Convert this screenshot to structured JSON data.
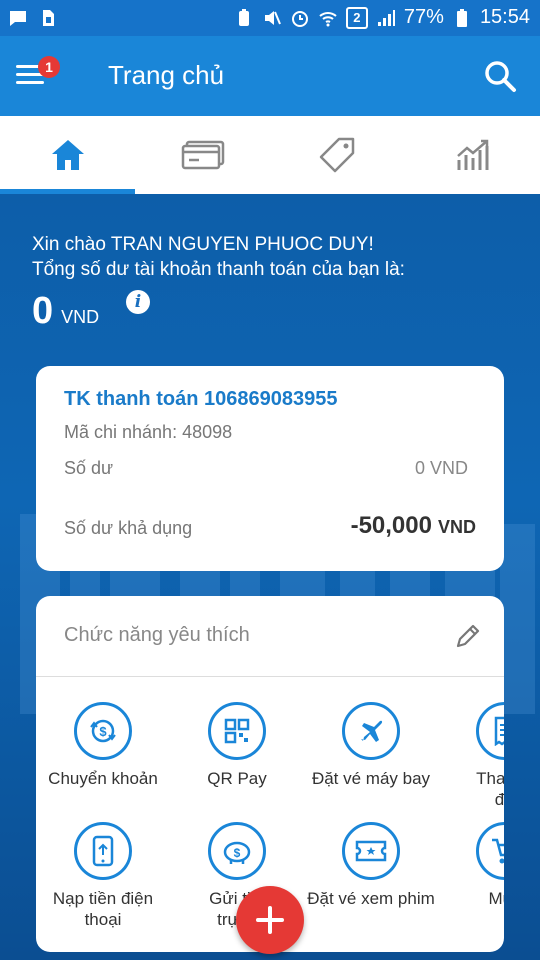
{
  "status_bar": {
    "battery": "77%",
    "time": "15:54",
    "sim_badge": "2"
  },
  "app_bar": {
    "title": "Trang chủ",
    "menu_badge": "1"
  },
  "tabs": [
    "home-icon",
    "card-icon",
    "tag-icon",
    "chart-icon"
  ],
  "hero": {
    "greeting": "Xin chào TRAN NGUYEN PHUOC DUY!",
    "subtitle": "Tổng số dư tài khoản thanh toán của bạn là:",
    "total_balance": "0",
    "currency": "VND"
  },
  "account_card": {
    "title": "TK thanh toán 106869083955",
    "branch": "Mã chi nhánh: 48098",
    "balance_label": "Số dư",
    "balance_value": "0 VND",
    "available_label": "Số dư khả dụng",
    "available_value": "-50,000",
    "available_currency": "VND"
  },
  "favorites": {
    "title": "Chức năng yêu thích",
    "items": [
      {
        "label": "Chuyển khoản",
        "icon": "transfer-icon"
      },
      {
        "label": "QR Pay",
        "icon": "qr-icon"
      },
      {
        "label": "Đặt vé máy bay",
        "icon": "plane-icon"
      },
      {
        "label": "Thanh t",
        "label2": "đơ",
        "icon": "bill-icon"
      },
      {
        "label": "Nạp tiền điện",
        "label2": "thoại",
        "icon": "phone-topup-icon"
      },
      {
        "label": "Gửi tiết",
        "label2": "trực t",
        "icon": "piggy-icon"
      },
      {
        "label": "Đặt vé xem phim",
        "icon": "ticket-icon"
      },
      {
        "label": "Mua",
        "icon": "cart-icon"
      }
    ]
  },
  "colors": {
    "primary": "#1a86d8",
    "status_bar": "#1673c9",
    "hero": "#0b5aa6",
    "fab": "#e53935",
    "account_title": "#1a7bc9"
  }
}
